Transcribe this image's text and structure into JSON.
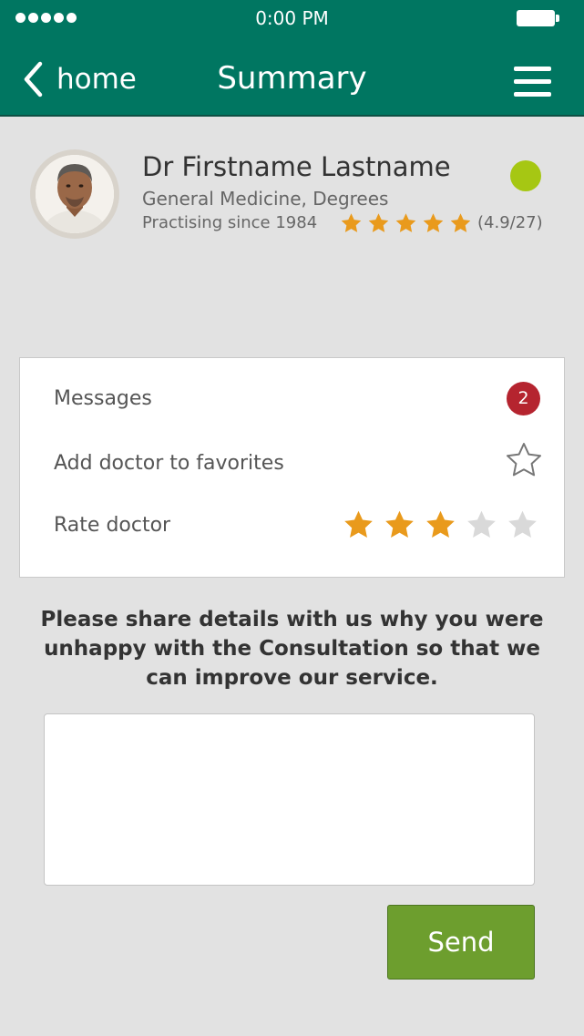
{
  "status_bar": {
    "time": "0:00 PM"
  },
  "header": {
    "back_label": "home",
    "title": "Summary"
  },
  "doctor": {
    "name": "Dr Firstname Lastname",
    "specialty": "General Medicine, Degrees",
    "practising": "Practising since 1984",
    "rating_text": "(4.9/27)",
    "rating_stars_filled": 5,
    "online_color": "#a6c713"
  },
  "actions": {
    "messages_label": "Messages",
    "messages_count": "2",
    "favorites_label": "Add doctor to favorites",
    "rate_label": "Rate doctor",
    "rate_value": 3,
    "rate_max": 5
  },
  "feedback": {
    "prompt": "Please share details with us why you were unhappy with the Consultation so that we can improve our service.",
    "placeholder": "",
    "send_label": "Send"
  },
  "colors": {
    "header": "#007661",
    "star_filled": "#e99a1c",
    "star_empty": "#d9d9d9",
    "badge": "#b5242f",
    "send_button": "#6d9e2e"
  }
}
